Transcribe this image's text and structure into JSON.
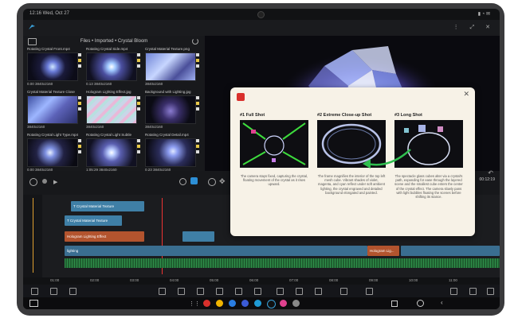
{
  "status": {
    "time": "12:16 Wed, Oct 27"
  },
  "media": {
    "header": "Files • Imported • Crystal Bloom",
    "clips": [
      {
        "name": "Rotating Crystal Front.mp4",
        "meta": "0.00 3840x2160"
      },
      {
        "name": "Rotating Crystal Side.mp4",
        "meta": "0.13 3840x2160"
      },
      {
        "name": "Crystal Material Texture.png",
        "meta": "3840x2160"
      },
      {
        "name": "Crystal Material Texture Close",
        "meta": "3840x2160"
      },
      {
        "name": "Hologram Lighting Effect.jpg",
        "meta": "3840x2160"
      },
      {
        "name": "Background with Lighting.jpg",
        "meta": "3840x2160"
      },
      {
        "name": "Rotating Crystal Light Type.mp4",
        "meta": "0.00 3840x2160"
      },
      {
        "name": "Rotating Crystal Light Subtle",
        "meta": "1:05:29 3840x2160"
      },
      {
        "name": "Rotating Crystal Detail.mp4",
        "meta": "0.23 3840x2160"
      }
    ]
  },
  "timeline": {
    "tracks": [
      {
        "label": "T Crystal Material Texture"
      },
      {
        "label": "T Crystal Material Texture"
      },
      {
        "label": "Hologram Lighting Effect"
      }
    ],
    "main_label": "lighting",
    "overlay_label": "Hologram Lig...",
    "ruler": [
      "01:00",
      "02:00",
      "03:00",
      "04:00",
      "05:00",
      "06:00",
      "07:00",
      "08:00",
      "09:00",
      "10:00",
      "11:00"
    ],
    "time_readout": "00:12:19"
  },
  "popup": {
    "shots": [
      {
        "title": "#1 Full Shot",
        "desc": "The camera stays fixed, capturing the crystal, floating movement of the crystal as it rises upward."
      },
      {
        "title": "#2 Extreme Close-up Shot",
        "desc": "The frame magnifies the interior of the top left mesh cube. Vibrant shades of violet, magenta, and cyan reflect under soft ambient lighting, the crystal engraved and detailed background elongated and painted."
      },
      {
        "title": "#3 Long Shot",
        "desc": "The spectacle glass cubes alter via a crystal's path, expanding for ease through the layered scene and the smallest cube enters the center of the crystal effect. The camera slowly pans with light bubbles floating the scenes before shifting its stance."
      }
    ]
  },
  "colors": {
    "accent": "#2d8fd6",
    "popup_bg": "#f7f2e7",
    "track_blue": "#3f7fa6",
    "track_orange": "#b3542e"
  }
}
